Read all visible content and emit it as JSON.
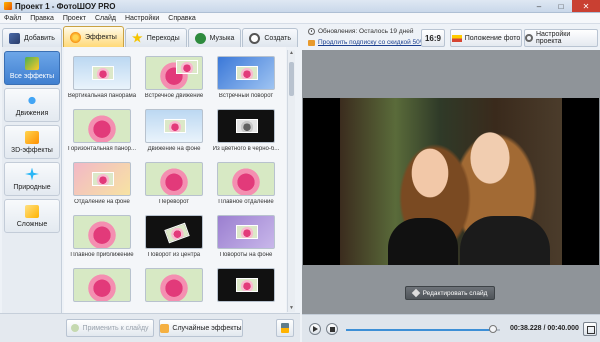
{
  "window": {
    "title": "Проект 1 - ФотоШОУ PRO"
  },
  "menu": [
    "Файл",
    "Правка",
    "Проект",
    "Слайд",
    "Настройки",
    "Справка"
  ],
  "tabs": [
    {
      "label": "Добавить",
      "icon": "add-icon"
    },
    {
      "label": "Эффекты",
      "icon": "effects-icon",
      "active": true
    },
    {
      "label": "Переходы",
      "icon": "star-icon"
    },
    {
      "label": "Музыка",
      "icon": "music-icon"
    },
    {
      "label": "Создать",
      "icon": "create-icon"
    }
  ],
  "info": {
    "update_text": "Обновления: Осталось 19 дней",
    "promo_text": "Продлить подписку со скидкой 50%"
  },
  "top_buttons": {
    "ratio": "16:9",
    "photo_position": "Положение фото",
    "project_settings": "Настройки проекта"
  },
  "categories": [
    {
      "label": "Все эффекты",
      "icon": "all-effects-icon",
      "active": true
    },
    {
      "label": "Движения",
      "icon": "motion-icon"
    },
    {
      "label": "3D-эффекты",
      "icon": "3d-effects-icon"
    },
    {
      "label": "Природные",
      "icon": "nature-icon"
    },
    {
      "label": "Сложные",
      "icon": "complex-icon"
    }
  ],
  "effects": [
    "Вертикальная панорама",
    "Встречное движение",
    "Встречный поворот",
    "Горизонтальная панор...",
    "Движение на фоне",
    "Из цветного в черно-б...",
    "Отдаление на фоне",
    "Переворот",
    "Плавное отдаление",
    "Плавное приближение",
    "Поворот из центра",
    "Повороты на фоне",
    "",
    "",
    ""
  ],
  "bottom_buttons": {
    "apply": "Применить к слайду",
    "random": "Случайные эффекты"
  },
  "preview": {
    "edit_slide": "Редактировать слайд"
  },
  "player": {
    "time": "00:38.228 / 00:40.000",
    "progress": 0.955
  },
  "colors": {
    "accent": "#3f7fd0",
    "active_tab": "#ffd978",
    "close": "#c94032"
  }
}
